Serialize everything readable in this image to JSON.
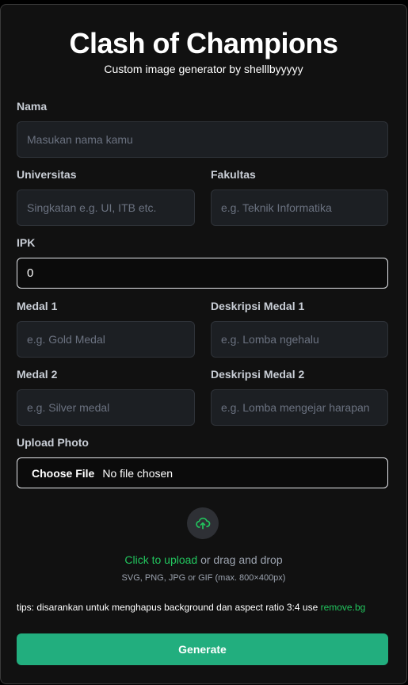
{
  "header": {
    "title": "Clash of Champions",
    "subtitle": "Custom image generator by shelllbyyyyy"
  },
  "form": {
    "nama": {
      "label": "Nama",
      "placeholder": "Masukan nama kamu"
    },
    "universitas": {
      "label": "Universitas",
      "placeholder": "Singkatan e.g. UI, ITB etc."
    },
    "fakultas": {
      "label": "Fakultas",
      "placeholder": "e.g. Teknik Informatika"
    },
    "ipk": {
      "label": "IPK",
      "value": "0"
    },
    "medal1": {
      "label": "Medal 1",
      "placeholder": "e.g. Gold Medal"
    },
    "desc_medal1": {
      "label": "Deskripsi Medal 1",
      "placeholder": "e.g. Lomba ngehalu"
    },
    "medal2": {
      "label": "Medal 2",
      "placeholder": "e.g. Silver medal"
    },
    "desc_medal2": {
      "label": "Deskripsi Medal 2",
      "placeholder": "e.g. Lomba mengejar harapan"
    },
    "photo": {
      "label": "Upload Photo",
      "choose_label": "Choose File",
      "status": "No file chosen"
    }
  },
  "upload": {
    "icon": "cloud-upload-icon",
    "click_text": "Click to upload",
    "drag_text": " or drag and drop",
    "formats": "SVG, PNG, JPG or GIF (max. 800×400px)"
  },
  "tips": {
    "text": "tips: disarankan untuk menghapus background dan aspect ratio 3:4 use ",
    "link": "remove.bg"
  },
  "actions": {
    "generate_label": "Generate"
  },
  "colors": {
    "accent": "#22c55e",
    "button": "#22ae7e",
    "background": "#111111"
  }
}
